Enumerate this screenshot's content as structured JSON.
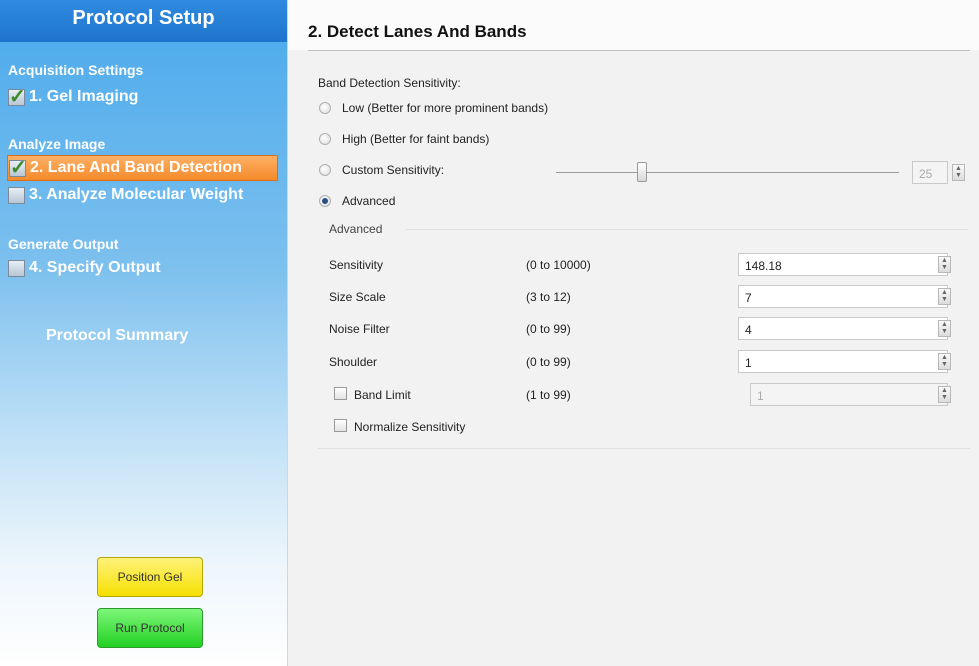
{
  "sidebar": {
    "title": "Protocol Setup",
    "sections": [
      {
        "heading": "Acquisition Settings",
        "steps": [
          {
            "label": "1. Gel Imaging",
            "checked": true,
            "active": false
          }
        ]
      },
      {
        "heading": "Analyze Image",
        "steps": [
          {
            "label": "2. Lane And Band Detection",
            "checked": true,
            "active": true
          },
          {
            "label": "3. Analyze Molecular Weight",
            "checked": false,
            "active": false
          }
        ]
      },
      {
        "heading": "Generate Output",
        "steps": [
          {
            "label": "4. Specify Output",
            "checked": false,
            "active": false
          }
        ]
      }
    ],
    "summary": "Protocol Summary",
    "position_gel": "Position Gel",
    "run_protocol": "Run Protocol"
  },
  "main": {
    "title": "2. Detect Lanes And Bands",
    "sensitivity_label": "Band Detection Sensitivity:",
    "options": [
      {
        "label": "Low (Better for more prominent bands)",
        "selected": false
      },
      {
        "label": "High (Better for faint bands)",
        "selected": false
      },
      {
        "label": "Custom Sensitivity:",
        "selected": false
      },
      {
        "label": "Advanced",
        "selected": true
      }
    ],
    "custom_value": "25",
    "custom_fraction": 0.25,
    "advanced_heading": "Advanced",
    "params": [
      {
        "name": "Sensitivity",
        "range": "(0 to 10000)",
        "value": "148.18"
      },
      {
        "name": "Size Scale",
        "range": "(3 to 12)",
        "value": "7"
      },
      {
        "name": "Noise Filter",
        "range": "(0 to 99)",
        "value": "4"
      },
      {
        "name": "Shoulder",
        "range": "(0 to 99)",
        "value": "1"
      },
      {
        "name": "Band Limit",
        "range": "(1 to 99)",
        "value": "1"
      }
    ],
    "normalize": "Normalize Sensitivity"
  },
  "colors": {
    "accent": "#f48a2a",
    "header": "#1f74cc",
    "yellow_button": "#f5e000",
    "green_button": "#22d022"
  }
}
